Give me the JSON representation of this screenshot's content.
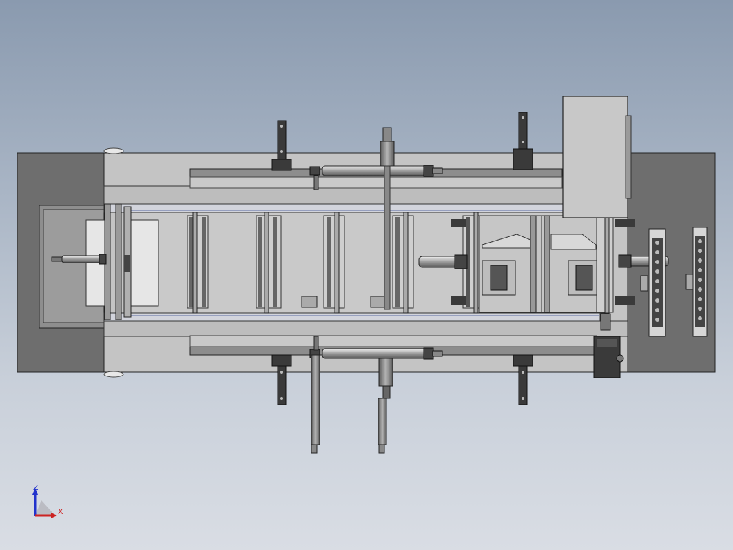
{
  "viewport": {
    "background_top": "#8a9aaf",
    "background_bottom": "#d9dde4",
    "view_orientation": "top"
  },
  "model": {
    "frame_color": "#bfbfbf",
    "base_plate_color": "#6e6e6e",
    "rail_color": "#d2d4dc",
    "dark_part_color": "#3a3a3a",
    "stations": 8,
    "cylinders": 5,
    "clamp_brackets": 4
  },
  "triad": {
    "z_label": "Z",
    "x_label": "X",
    "z_color": "#2233cc",
    "x_color": "#cc2222"
  }
}
